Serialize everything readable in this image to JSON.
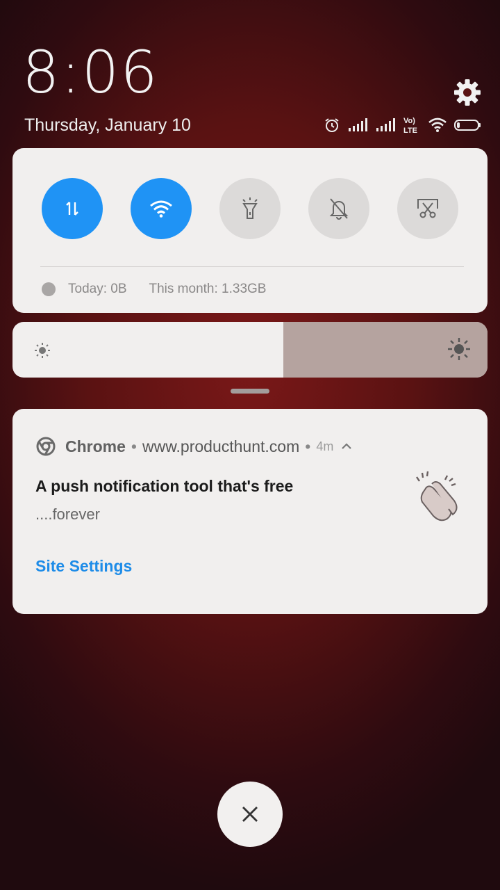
{
  "lockscreen": {
    "time": "8:06",
    "date": "Thursday, January 10"
  },
  "status_bar": {
    "icons": [
      "alarm-icon",
      "signal-icon",
      "signal-icon",
      "volte-icon",
      "wifi-icon",
      "battery-icon"
    ],
    "volte_label_top": "Vo)",
    "volte_label_bottom": "LTE"
  },
  "settings_icon": "gear-icon",
  "quick_settings": {
    "toggles": [
      {
        "name": "mobile-data",
        "icon": "data-arrows-icon",
        "on": true
      },
      {
        "name": "wifi",
        "icon": "wifi-icon",
        "on": true
      },
      {
        "name": "flashlight",
        "icon": "flashlight-icon",
        "on": false
      },
      {
        "name": "silent",
        "icon": "bell-off-icon",
        "on": false
      },
      {
        "name": "screenshot",
        "icon": "scissors-icon",
        "on": false
      }
    ],
    "usage_today": "Today: 0B",
    "usage_month": "This month: 1.33GB"
  },
  "brightness": {
    "level": 0.57
  },
  "notification": {
    "app": "Chrome",
    "url": "www.producthunt.com",
    "time": "4m",
    "title": "A push notification tool that's free",
    "body": "....forever",
    "action": "Site Settings",
    "separator": "•"
  },
  "colors": {
    "accent": "#1f93f5",
    "link": "#1e8ce8",
    "card": "#f1efee",
    "toggle_off": "#dcdad9",
    "brightness_fill": "#b5a39f"
  }
}
